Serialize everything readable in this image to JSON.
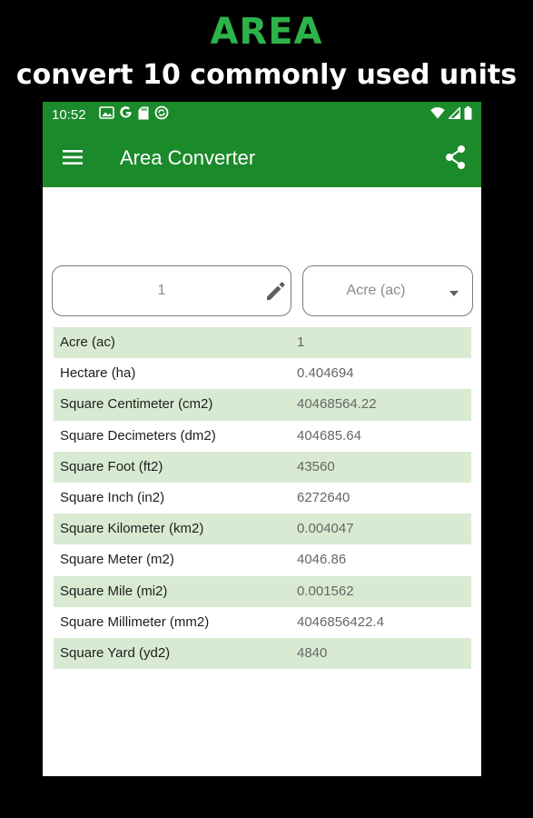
{
  "promo": {
    "title": "AREA",
    "subtitle": "convert 10 commonly used units"
  },
  "status_bar": {
    "time": "10:52",
    "left_icons": [
      "image-icon",
      "google-icon",
      "sd-card-icon",
      "sync-icon"
    ],
    "right_icons": [
      "wifi-icon",
      "signal-icon",
      "battery-icon"
    ]
  },
  "app_bar": {
    "title": "Area Converter",
    "menu_icon": "menu-icon",
    "share_icon": "share-icon"
  },
  "input": {
    "value": "1",
    "edit_icon": "pencil-icon"
  },
  "unit_select": {
    "selected": "Acre (ac)",
    "dropdown_icon": "caret-down-icon"
  },
  "results": [
    {
      "unit": "Acre (ac)",
      "value": "1"
    },
    {
      "unit": "Hectare (ha)",
      "value": "0.404694"
    },
    {
      "unit": "Square Centimeter (cm2)",
      "value": "40468564.22"
    },
    {
      "unit": "Square Decimeters (dm2)",
      "value": "404685.64"
    },
    {
      "unit": "Square Foot (ft2)",
      "value": "43560"
    },
    {
      "unit": "Square Inch (in2)",
      "value": "6272640"
    },
    {
      "unit": "Square Kilometer (km2)",
      "value": "0.004047"
    },
    {
      "unit": "Square Meter (m2)",
      "value": "4046.86"
    },
    {
      "unit": "Square Mile (mi2)",
      "value": "0.001562"
    },
    {
      "unit": "Square Millimeter (mm2)",
      "value": "4046856422.4"
    },
    {
      "unit": "Square Yard (yd2)",
      "value": "4840"
    }
  ],
  "colors": {
    "brand_green": "#1b8a2a",
    "promo_green": "#2eb24a",
    "row_shade": "#d8ebd2"
  }
}
